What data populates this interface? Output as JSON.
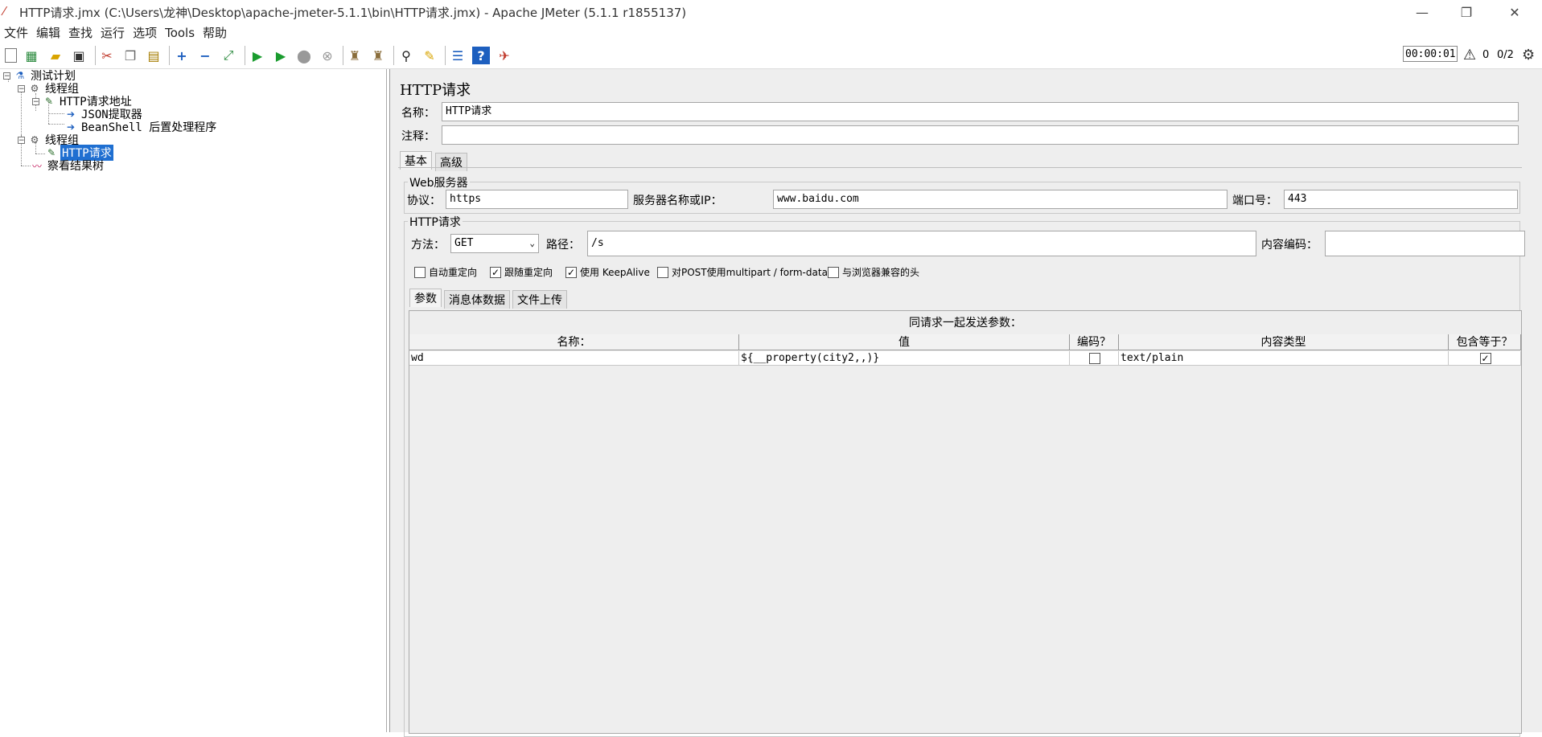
{
  "window": {
    "title": "HTTP请求.jmx (C:\\Users\\龙神\\Desktop\\apache-jmeter-5.1.1\\bin\\HTTP请求.jmx) - Apache JMeter (5.1.1 r1855137)",
    "minimize": "—",
    "restore": "❐",
    "close": "✕"
  },
  "menu": [
    "文件",
    "编辑",
    "查找",
    "运行",
    "选项",
    "Tools",
    "帮助"
  ],
  "toolbar": {
    "timer": "00:00:01",
    "warning_count": "0",
    "threads": "0/2",
    "icons": [
      "new-icon",
      "templates-icon",
      "open-icon",
      "save-icon",
      "cut-icon",
      "copy-icon",
      "paste-icon",
      "expand-icon",
      "collapse-icon",
      "toggle-icon",
      "start-icon",
      "start-no-pause-icon",
      "stop-icon",
      "shutdown-icon",
      "clear-icon",
      "clear-all-icon",
      "search-icon",
      "reset-search-icon",
      "function-helper-icon",
      "help-icon",
      "remote-icon"
    ]
  },
  "tree": {
    "items": [
      {
        "label": "测试计划",
        "icon": "test-plan-icon"
      },
      {
        "label": "线程组",
        "icon": "thread-group-icon"
      },
      {
        "label": "HTTP请求地址",
        "icon": "sampler-icon"
      },
      {
        "label": "JSON提取器",
        "icon": "extractor-icon"
      },
      {
        "label": "BeanShell 后置处理程序",
        "icon": "postprocessor-icon"
      },
      {
        "label": "线程组",
        "icon": "thread-group-icon"
      },
      {
        "label": "HTTP请求",
        "icon": "sampler-icon"
      },
      {
        "label": "察看结果树",
        "icon": "listener-icon"
      }
    ]
  },
  "panel": {
    "header": "HTTP请求",
    "name_label": "名称：",
    "name_value": "HTTP请求",
    "comment_label": "注释：",
    "comment_value": "",
    "tabs": [
      "基本",
      "高级"
    ],
    "web_server": {
      "title": "Web服务器",
      "protocol_label": "协议：",
      "protocol_value": "https",
      "server_label": "服务器名称或IP：",
      "server_value": "www.baidu.com",
      "port_label": "端口号：",
      "port_value": "443"
    },
    "http_request": {
      "title": "HTTP请求",
      "method_label": "方法：",
      "method_value": "GET",
      "path_label": "路径：",
      "path_value": "/s",
      "encoding_label": "内容编码：",
      "encoding_value": ""
    },
    "options": [
      {
        "label": "自动重定向",
        "checked": false
      },
      {
        "label": "跟随重定向",
        "checked": true
      },
      {
        "label": "使用 KeepAlive",
        "checked": true
      },
      {
        "label": "对POST使用multipart / form-data",
        "checked": false
      },
      {
        "label": "与浏览器兼容的头",
        "checked": false
      }
    ],
    "sub_tabs": [
      "参数",
      "消息体数据",
      "文件上传"
    ],
    "params": {
      "caption": "同请求一起发送参数：",
      "columns": [
        "名称：",
        "值",
        "编码？",
        "内容类型",
        "包含等于？"
      ],
      "rows": [
        {
          "name": "wd",
          "value": "${__property(city2,,)}",
          "encode": false,
          "content_type": "text/plain",
          "include_equals": true
        }
      ]
    }
  }
}
